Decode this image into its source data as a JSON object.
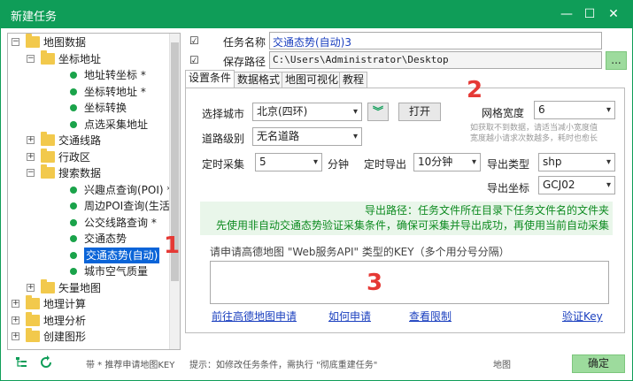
{
  "window": {
    "title": "新建任务",
    "minimize": "—",
    "maximize": "☐",
    "close": "✕"
  },
  "tree": [
    {
      "label": "地图数据",
      "kind": "folder",
      "level": 0,
      "expander": "−"
    },
    {
      "label": "坐标地址",
      "kind": "folder",
      "level": 1,
      "expander": "−"
    },
    {
      "label": "地址转坐标 *",
      "kind": "leaf",
      "level": 2
    },
    {
      "label": "坐标转地址 *",
      "kind": "leaf",
      "level": 2
    },
    {
      "label": "坐标转换",
      "kind": "leaf",
      "level": 2
    },
    {
      "label": "点选采集地址",
      "kind": "leaf",
      "level": 2
    },
    {
      "label": "交通线路",
      "kind": "folder",
      "level": 1,
      "expander": "+"
    },
    {
      "label": "行政区",
      "kind": "folder",
      "level": 1,
      "expander": "+"
    },
    {
      "label": "搜索数据",
      "kind": "folder",
      "level": 1,
      "expander": "−"
    },
    {
      "label": "兴趣点查询(POI) *",
      "kind": "leaf",
      "level": 2
    },
    {
      "label": "周边POI查询(生活圈)",
      "kind": "leaf",
      "level": 2
    },
    {
      "label": "公交线路查询 *",
      "kind": "leaf",
      "level": 2
    },
    {
      "label": "交通态势",
      "kind": "leaf",
      "level": 2
    },
    {
      "label": "交通态势(自动)",
      "kind": "leaf",
      "level": 2,
      "selected": true
    },
    {
      "label": "城市空气质量",
      "kind": "leaf",
      "level": 2
    },
    {
      "label": "矢量地图",
      "kind": "folder",
      "level": 1,
      "expander": "+"
    },
    {
      "label": "地理计算",
      "kind": "folder",
      "level": 0,
      "expander": "+"
    },
    {
      "label": "地理分析",
      "kind": "folder",
      "level": 0,
      "expander": "+"
    },
    {
      "label": "创建图形",
      "kind": "folder",
      "level": 0,
      "expander": "+"
    }
  ],
  "task": {
    "name_label": "任务名称",
    "name_value": "交通态势(自动)3",
    "path_label": "保存路径",
    "path_value": "C:\\Users\\Administrator\\Desktop",
    "browse_label": "...",
    "check": "☑"
  },
  "tabs": [
    "设置条件",
    "数据格式",
    "地图可视化",
    "教程"
  ],
  "settings": {
    "city_label": "选择城市",
    "city_value": "北京(四环)",
    "open_label": "打开",
    "expand_glyph": "︾",
    "grid_label": "网格宽度",
    "grid_value": "6",
    "grid_note": "如获取不到数据，请适当减小宽度值\n宽度越小请求次数越多，耗时也愈长",
    "road_label": "道路级别",
    "road_value": "无名道路",
    "timer_label": "定时采集",
    "timer_value": "5",
    "timer_unit": "分钟",
    "export_label": "定时导出",
    "export_value": "10分钟",
    "type_label": "导出类型",
    "type_value": "shp",
    "coord_label": "导出坐标",
    "coord_value": "GCJ02",
    "export_path_note": "导出路径：任务文件所在目录下任务文件名的文件夹",
    "verify_note": "先使用非自动交通态势验证采集条件，确保可采集并导出成功，再使用当前自动采集",
    "key_prompt": "请申请高德地图 \"Web服务API\" 类型的KEY（多个用分号分隔）",
    "key_value": ""
  },
  "links": [
    "前往高德地图申请",
    "如何申请",
    "查看限制",
    "验证Key"
  ],
  "markers": [
    "1",
    "2",
    "3"
  ],
  "status": {
    "key_hint": "带 * 推荐申请地图KEY",
    "tip": "提示：如修改任务条件，需执行 \"彻底重建任务\"",
    "map": "地图",
    "ok_label": "确定"
  },
  "colors": {
    "accent": "#0f9d58",
    "selection": "#0a64d8",
    "marker": "#e53935",
    "note_green": "#0c8a1f"
  }
}
